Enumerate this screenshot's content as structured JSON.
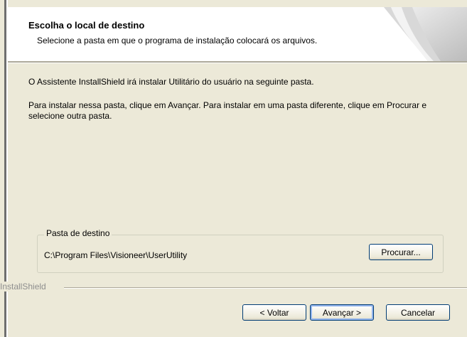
{
  "header": {
    "title": "Escolha o local de destino",
    "subtitle": "Selecione a pasta em que o programa de instalação colocará os arquivos."
  },
  "body": {
    "intro": "O Assistente InstallShield irá instalar Utilitário do usuário na seguinte pasta.",
    "instructions": "Para instalar nessa pasta, clique em Avançar. Para instalar em uma pasta diferente, clique em Procurar e selecione outra pasta."
  },
  "destination": {
    "group_label": "Pasta de destino",
    "path": "C:\\Program Files\\Visioneer\\UserUtility",
    "browse_label": "Procurar..."
  },
  "footer": {
    "brand": "InstallShield",
    "back_label": "< Voltar",
    "next_label": "Avançar >",
    "cancel_label": "Cancelar"
  },
  "colors": {
    "dialog_bg": "#ece9d8",
    "header_bg": "#ffffff",
    "button_border": "#003c74"
  }
}
